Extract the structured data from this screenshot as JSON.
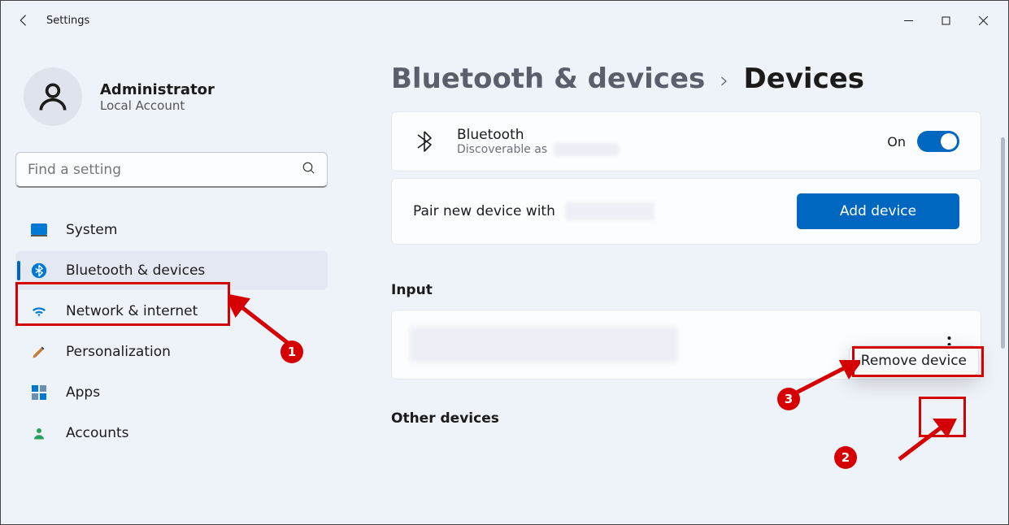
{
  "titlebar": {
    "title": "Settings"
  },
  "user": {
    "name": "Administrator",
    "type": "Local Account"
  },
  "search": {
    "placeholder": "Find a setting"
  },
  "nav": {
    "items": [
      {
        "label": "System"
      },
      {
        "label": "Bluetooth & devices"
      },
      {
        "label": "Network & internet"
      },
      {
        "label": "Personalization"
      },
      {
        "label": "Apps"
      },
      {
        "label": "Accounts"
      }
    ],
    "active_index": 1
  },
  "breadcrumb": {
    "parent": "Bluetooth & devices",
    "current": "Devices"
  },
  "bluetooth_card": {
    "title": "Bluetooth",
    "subtitle_prefix": "Discoverable as",
    "toggle_label": "On",
    "toggle_on": true
  },
  "pair_card": {
    "text_prefix": "Pair new device with",
    "button_label": "Add device"
  },
  "sections": {
    "input_header": "Input",
    "other_header": "Other devices"
  },
  "popup": {
    "remove_label": "Remove device"
  },
  "annotations": {
    "badge1": "1",
    "badge2": "2",
    "badge3": "3"
  }
}
